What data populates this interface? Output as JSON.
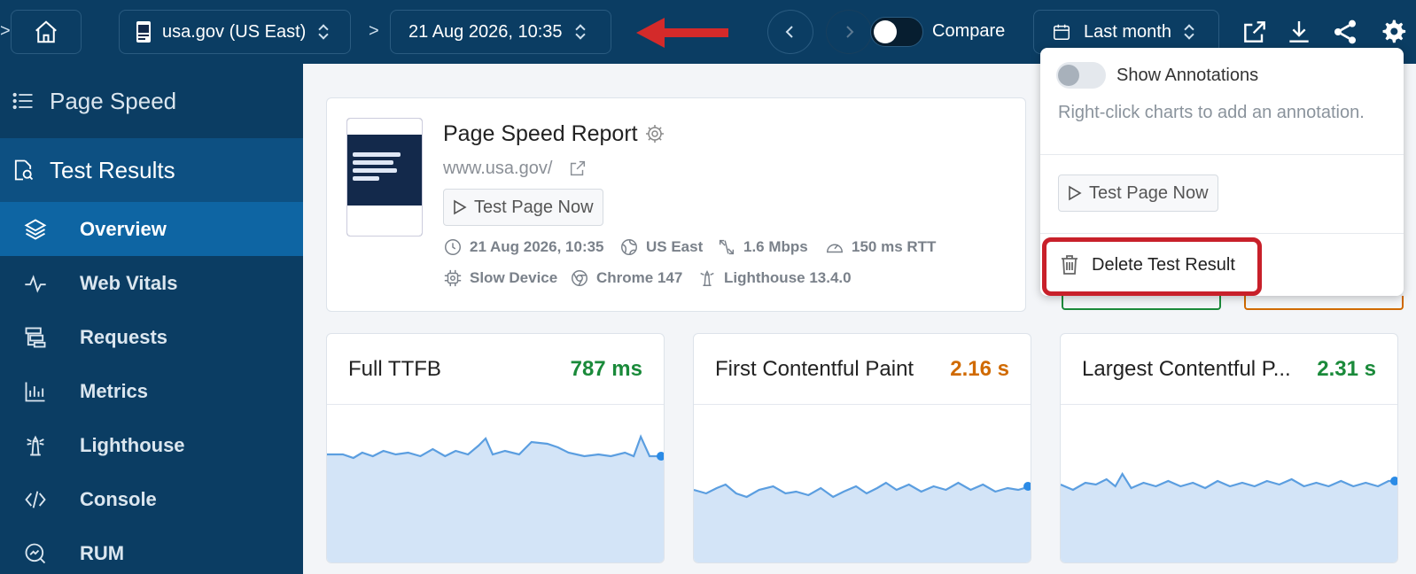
{
  "topbar": {
    "site_label": "usa.gov (US East)",
    "date_label": "21 Aug 2026, 10:35",
    "compare_label": "Compare",
    "range_label": "Last month",
    "compare_enabled": false
  },
  "sidebar": {
    "header": "Page Speed",
    "section": "Test Results",
    "items": [
      {
        "label": "Overview",
        "active": true
      },
      {
        "label": "Web Vitals"
      },
      {
        "label": "Requests"
      },
      {
        "label": "Metrics"
      },
      {
        "label": "Lighthouse"
      },
      {
        "label": "Console"
      },
      {
        "label": "RUM"
      }
    ]
  },
  "report": {
    "title": "Page Speed Report",
    "url": "www.usa.gov/",
    "test_button": "Test Page Now",
    "meta": {
      "date": "21 Aug 2026, 10:35",
      "location": "US East",
      "bandwidth": "1.6 Mbps",
      "rtt": "150 ms RTT",
      "device": "Slow Device",
      "browser": "Chrome 147",
      "lighthouse": "Lighthouse 13.4.0"
    }
  },
  "metrics": [
    {
      "name": "Full TTFB",
      "value": "787 ms",
      "status": "good"
    },
    {
      "name": "First Contentful Paint",
      "value": "2.16 s",
      "status": "needs-improvement"
    },
    {
      "name": "Largest Contentful P...",
      "value": "2.31 s",
      "status": "good"
    }
  ],
  "menu": {
    "show_annotations": "Show Annotations",
    "annotations_enabled": false,
    "hint": "Right-click charts to add an annotation.",
    "test_button": "Test Page Now",
    "delete": "Delete Test Result"
  },
  "colors": {
    "topbar": "#0b3d63",
    "active_item": "#0e65a3",
    "good": "#1a8a3a",
    "warn": "#d06a00",
    "highlight": "#c8202a"
  }
}
